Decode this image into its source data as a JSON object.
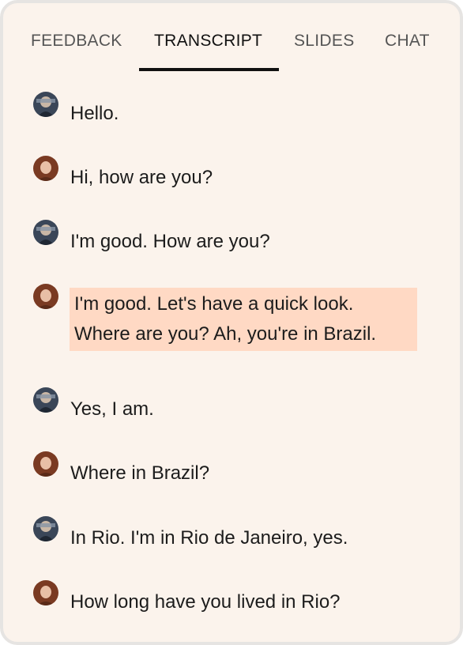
{
  "tabs": [
    {
      "label": "FEEDBACK",
      "active": false
    },
    {
      "label": "TRANSCRIPT",
      "active": true
    },
    {
      "label": "SLIDES",
      "active": false
    },
    {
      "label": "CHAT",
      "active": false
    }
  ],
  "transcript": [
    {
      "speaker_icon": "avatar-man-icon",
      "text": "Hello.",
      "highlighted": false
    },
    {
      "speaker_icon": "avatar-woman-icon",
      "text": "Hi, how are you?",
      "highlighted": false
    },
    {
      "speaker_icon": "avatar-man-icon",
      "text": "I'm good. How are you?",
      "highlighted": false
    },
    {
      "speaker_icon": "avatar-woman-icon",
      "text": "I'm good. Let's have a quick look. Where are you? Ah, you're in Brazil.",
      "highlighted": true
    },
    {
      "speaker_icon": "avatar-man-icon",
      "text": "Yes, I am.",
      "highlighted": false
    },
    {
      "speaker_icon": "avatar-woman-icon",
      "text": "Where in Brazil?",
      "highlighted": false
    },
    {
      "speaker_icon": "avatar-man-icon",
      "text": "In Rio. I'm in Rio de Janeiro, yes.",
      "highlighted": false
    },
    {
      "speaker_icon": "avatar-woman-icon",
      "text": "How long have you lived in Rio?",
      "highlighted": false
    }
  ],
  "colors": {
    "panel_background": "#fbf3ec",
    "highlight": "#ffd9c4",
    "active_tab_underline": "#111111"
  }
}
